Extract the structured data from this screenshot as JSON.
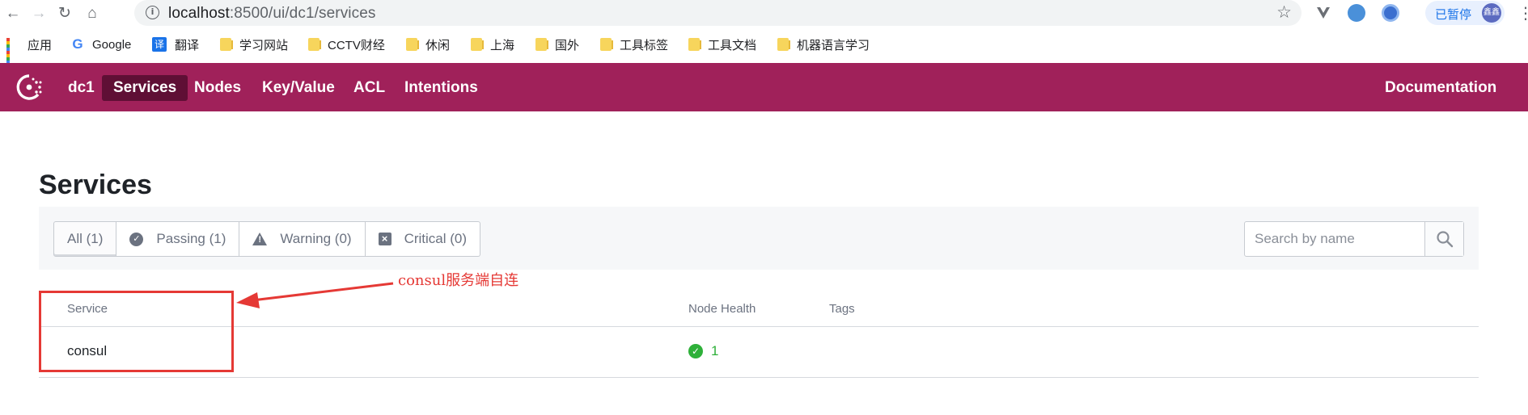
{
  "browser": {
    "url_host": "localhost",
    "url_rest": ":8500/ui/dc1/services",
    "profile_status": "已暂停",
    "profile_avatar": "鑫鑫"
  },
  "bookmarks": [
    {
      "label": "应用",
      "icon": "apps-grid-icon"
    },
    {
      "label": "Google",
      "icon": "google-icon"
    },
    {
      "label": "翻译",
      "icon": "translate-icon"
    },
    {
      "label": "学习网站",
      "icon": "folder-icon"
    },
    {
      "label": "CCTV财经",
      "icon": "folder-icon"
    },
    {
      "label": "休闲",
      "icon": "folder-icon"
    },
    {
      "label": "上海",
      "icon": "folder-icon"
    },
    {
      "label": "国外",
      "icon": "folder-icon"
    },
    {
      "label": "工具标签",
      "icon": "folder-icon"
    },
    {
      "label": "工具文档",
      "icon": "folder-icon"
    },
    {
      "label": "机器语言学习",
      "icon": "folder-icon"
    }
  ],
  "nav": {
    "datacenter": "dc1",
    "items": [
      "Services",
      "Nodes",
      "Key/Value",
      "ACL",
      "Intentions"
    ],
    "active": "Services",
    "documentation": "Documentation",
    "color": "#a0215a",
    "active_color": "#5f0f35"
  },
  "page": {
    "title": "Services"
  },
  "filters": {
    "tabs": [
      {
        "label": "All (1)",
        "icon": ""
      },
      {
        "label": "Passing (1)",
        "icon": "check-circle-icon"
      },
      {
        "label": "Warning (0)",
        "icon": "warning-icon"
      },
      {
        "label": "Critical (0)",
        "icon": "x-square-icon"
      }
    ],
    "search_placeholder": "Search by name"
  },
  "table": {
    "columns": [
      "Service",
      "Node Health",
      "Tags"
    ],
    "rows": [
      {
        "service": "consul",
        "node_health": "1",
        "health_status": "passing",
        "tags": ""
      }
    ]
  },
  "annotation": {
    "text": "consul服务端自连",
    "color": "#e53935"
  }
}
